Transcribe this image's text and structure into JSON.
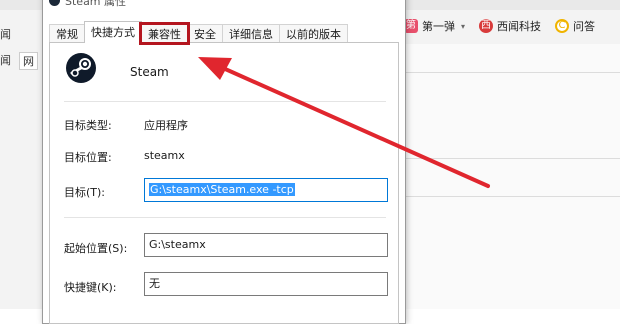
{
  "background_browser": {
    "bookmarks": [
      {
        "label": "第一弹",
        "icon": "diyidan-icon",
        "color": "#e8506c",
        "glyph": "第",
        "has_caret": true
      },
      {
        "label": "西闻科技",
        "icon": "xiwen-icon",
        "color": "#d83b3b",
        "glyph": "西",
        "has_caret": false
      },
      {
        "label": "问答",
        "icon": "wenda-icon",
        "color": "#f0b400",
        "glyph": "C",
        "has_caret": false
      }
    ],
    "left_fragments": {
      "line1": "闻",
      "line2_a": "闻",
      "line2_b": "网"
    }
  },
  "dialog": {
    "title": "Steam 属性",
    "tabs": [
      {
        "label": "常规",
        "state": "normal"
      },
      {
        "label": "快捷方式",
        "state": "active"
      },
      {
        "label": "兼容性",
        "state": "highlighted"
      },
      {
        "label": "安全",
        "state": "normal"
      },
      {
        "label": "详细信息",
        "state": "normal"
      },
      {
        "label": "以前的版本",
        "state": "normal"
      }
    ],
    "app": {
      "name": "Steam",
      "icon": "steam-icon"
    },
    "rows": {
      "target_type": {
        "label": "目标类型:",
        "value": "应用程序"
      },
      "target_location": {
        "label": "目标位置:",
        "value": "steamx"
      },
      "target": {
        "label": "目标(T):",
        "value": "G:\\steamx\\Steam.exe -tcp"
      },
      "start_in": {
        "label": "起始位置(S):",
        "value": "G:\\steamx"
      },
      "shortcut_key": {
        "label": "快捷键(K):",
        "value": "无"
      }
    }
  },
  "annotation": {
    "highlight_color": "#b4151f",
    "arrow_color": "#e0262e"
  }
}
